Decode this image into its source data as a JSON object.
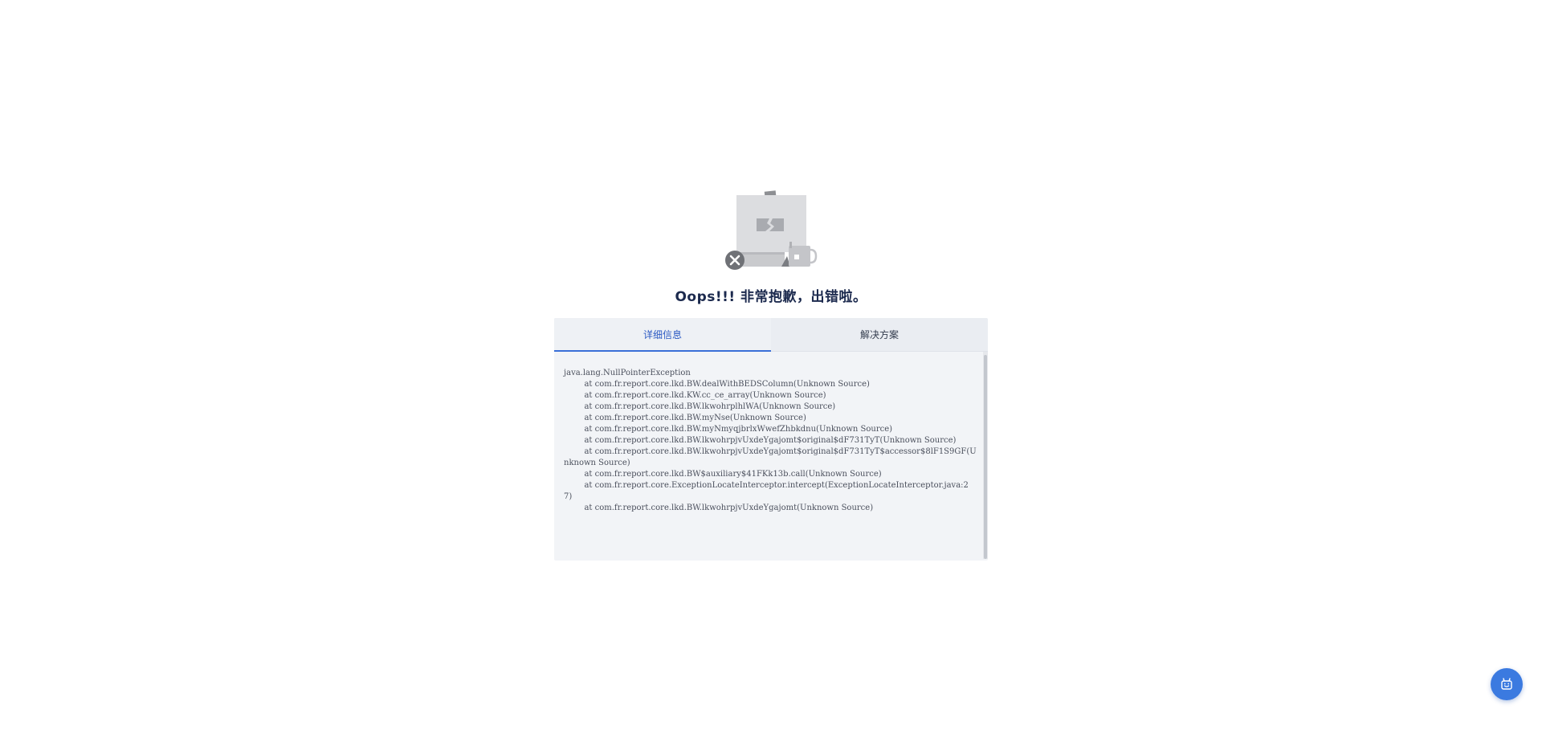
{
  "title": "Oops!!! 非常抱歉，出错啦。",
  "tabs": [
    {
      "label": "详细信息",
      "active": true
    },
    {
      "label": "解决方案",
      "active": false
    }
  ],
  "error": {
    "stack_trace": "java.lang.NullPointerException\n\tat com.fr.report.core.lkd.BW.dealWithBEDSColumn(Unknown Source)\n\tat com.fr.report.core.lkd.KW.cc_ce_array(Unknown Source)\n\tat com.fr.report.core.lkd.BW.lkwohrplhlWA(Unknown Source)\n\tat com.fr.report.core.lkd.BW.myNse(Unknown Source)\n\tat com.fr.report.core.lkd.BW.myNmyqjbrlxWwefZhbkdnu(Unknown Source)\n\tat com.fr.report.core.lkd.BW.lkwohrpjvUxdeYgajomt$original$dF731TyT(Unknown Source)\n\tat com.fr.report.core.lkd.BW.lkwohrpjvUxdeYgajomt$original$dF731TyT$accessor$8lF1S9GF(Unknown Source)\n\tat com.fr.report.core.lkd.BW$auxiliary$41FKk13b.call(Unknown Source)\n\tat com.fr.report.core.ExceptionLocateInterceptor.intercept(ExceptionLocateInterceptor.java:27)\n\tat com.fr.report.core.lkd.BW.lkwohrpjvUxdeYgajomt(Unknown Source)"
  },
  "colors": {
    "accent": "#3a6fd8",
    "title": "#1c2a4e",
    "panel_bg": "#f2f4f7",
    "float_button": "#3b7ae0"
  },
  "icons": {
    "illustration": "broken-image-illustration",
    "error_badge": "close-circle-icon",
    "float_button": "robot-assistant-icon"
  }
}
